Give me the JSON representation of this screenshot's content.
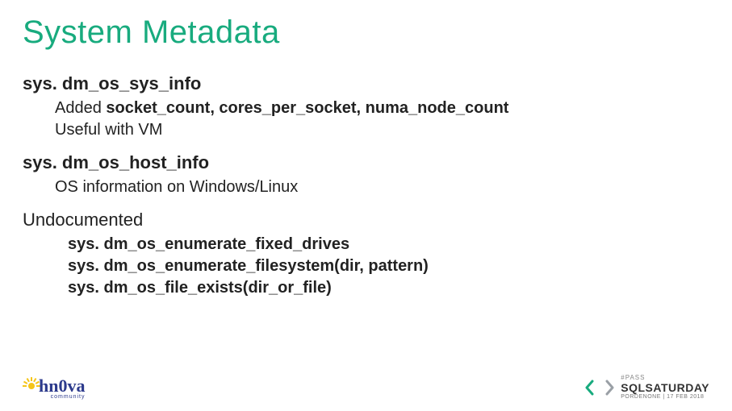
{
  "title": "System Metadata",
  "sections": [
    {
      "heading": "sys. dm_os_sys_info",
      "heading_bold": true,
      "lines": [
        {
          "prefix": "Added ",
          "bold": "socket_count, cores_per_socket, numa_node_count",
          "suffix": ""
        },
        {
          "plain": "Useful with VM"
        }
      ]
    },
    {
      "heading": "sys. dm_os_host_info",
      "heading_bold": true,
      "lines": [
        {
          "plain": "OS information on Windows/Linux"
        }
      ]
    },
    {
      "heading": "Undocumented",
      "heading_bold": false,
      "bold_lines": [
        "sys. dm_os_enumerate_fixed_drives",
        "sys. dm_os_enumerate_filesystem(dir, pattern)",
        "sys. dm_os_file_exists(dir_or_file)"
      ]
    }
  ],
  "footer": {
    "left_logo": {
      "text": "hn0va",
      "subtext": "community"
    },
    "right_logo": {
      "pass": "#PASS",
      "main": "SQLSATURDAY",
      "sub": "PORDENONE | 17 FEB 2018",
      "arrow_left_color": "#18ab7e",
      "arrow_right_color": "#9aa0a6"
    }
  }
}
